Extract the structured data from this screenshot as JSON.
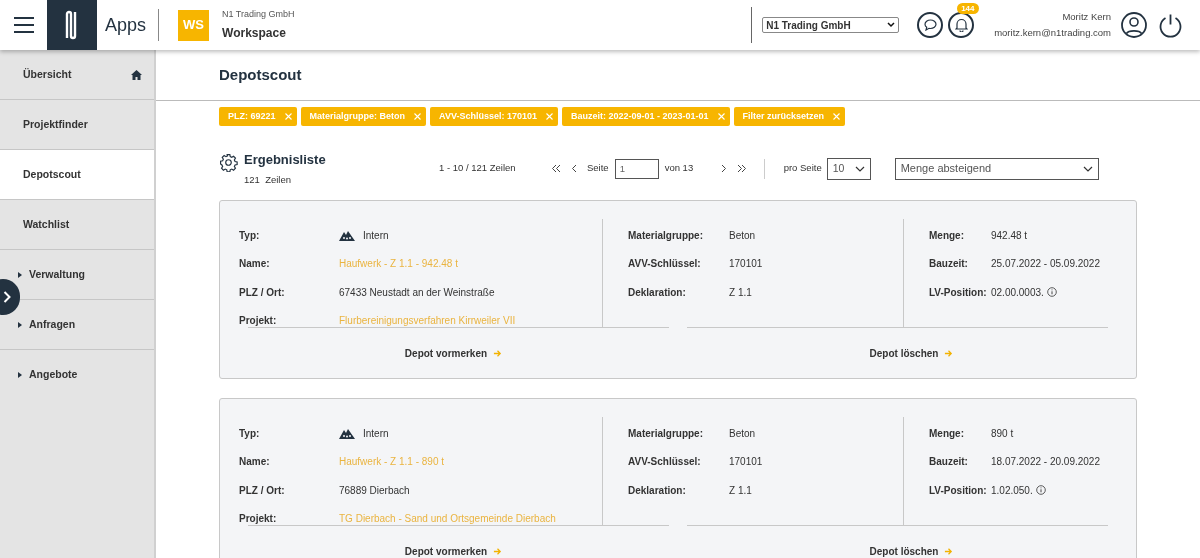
{
  "header": {
    "apps_label": "Apps",
    "workspace": {
      "badge": "WS",
      "company": "N1 Trading GmbH",
      "name": "Workspace"
    },
    "company_select": "N1 Trading GmbH",
    "notification_count": "144",
    "user": {
      "name": "Moritz Kern",
      "email": "moritz.kern@n1trading.com"
    }
  },
  "sidebar": {
    "items": [
      {
        "label": "Übersicht",
        "kind": "home",
        "selected": false
      },
      {
        "label": "Projektfinder",
        "kind": "link",
        "selected": false
      },
      {
        "label": "Depotscout",
        "kind": "link",
        "selected": true
      },
      {
        "label": "Watchlist",
        "kind": "link",
        "selected": false
      },
      {
        "label": "Verwaltung",
        "kind": "group",
        "selected": false,
        "expanded": false
      },
      {
        "label": "Anfragen",
        "kind": "group",
        "selected": false,
        "expanded": false
      },
      {
        "label": "Angebote",
        "kind": "group",
        "selected": false,
        "expanded": false
      }
    ]
  },
  "page_title": "Depotscout",
  "filters": [
    {
      "label": "PLZ: 69221"
    },
    {
      "label": "Materialgruppe: Beton"
    },
    {
      "label": "AVV-Schlüssel: 170101"
    },
    {
      "label": "Bauzeit: 2022-09-01 - 2023-01-01"
    },
    {
      "label": "Filter zurücksetzen"
    }
  ],
  "results": {
    "title": "Ergebnisliste",
    "count": "121  Zeilen"
  },
  "pagination": {
    "range": "1 - 10 / 121 Zeilen",
    "page_label": "Seite",
    "page_value": "1",
    "of_label": "von 13",
    "per_page_label": "pro Seite",
    "per_page": "10"
  },
  "sort": "Menge absteigend",
  "cards": [
    {
      "columns": [
        [
          {
            "label": "Typ:",
            "value": "Intern",
            "kind": "type"
          },
          {
            "label": "Name:",
            "value": "Haufwerk - Z 1.1 - 942.48 t",
            "kind": "link"
          },
          {
            "label": "PLZ / Ort:",
            "value": "67433 Neustadt an der Weinstraße",
            "kind": "text"
          },
          {
            "label": "Projekt:",
            "value": "Flurbereinigungsverfahren Kirrweiler VII",
            "kind": "link"
          }
        ],
        [
          {
            "label": "Materialgruppe:",
            "value": "Beton",
            "kind": "text"
          },
          {
            "label": "AVV-Schlüssel:",
            "value": "170101",
            "kind": "text"
          },
          {
            "label": "Deklaration:",
            "value": "Z 1.1",
            "kind": "text"
          }
        ],
        [
          {
            "label": "Menge:",
            "value": "942.48 t",
            "kind": "text"
          },
          {
            "label": "Bauzeit:",
            "value": "25.07.2022 - 05.09.2022",
            "kind": "text"
          },
          {
            "label": "LV-Position:",
            "value": "02.00.0003.",
            "kind": "info"
          }
        ]
      ],
      "actions": [
        "Depot vormerken",
        "Depot löschen"
      ]
    },
    {
      "columns": [
        [
          {
            "label": "Typ:",
            "value": "Intern",
            "kind": "type"
          },
          {
            "label": "Name:",
            "value": "Haufwerk - Z 1.1 - 890 t",
            "kind": "link"
          },
          {
            "label": "PLZ / Ort:",
            "value": "76889 Dierbach",
            "kind": "text"
          },
          {
            "label": "Projekt:",
            "value": "TG Dierbach - Sand und Ortsgemeinde Dierbach",
            "kind": "link"
          }
        ],
        [
          {
            "label": "Materialgruppe:",
            "value": "Beton",
            "kind": "text"
          },
          {
            "label": "AVV-Schlüssel:",
            "value": "170101",
            "kind": "text"
          },
          {
            "label": "Deklaration:",
            "value": "Z 1.1",
            "kind": "text"
          }
        ],
        [
          {
            "label": "Menge:",
            "value": "890 t",
            "kind": "text"
          },
          {
            "label": "Bauzeit:",
            "value": "18.07.2022 - 20.09.2022",
            "kind": "text"
          },
          {
            "label": "LV-Position:",
            "value": "1.02.050.",
            "kind": "info"
          }
        ]
      ],
      "actions": [
        "Depot vormerken",
        "Depot löschen"
      ]
    }
  ]
}
